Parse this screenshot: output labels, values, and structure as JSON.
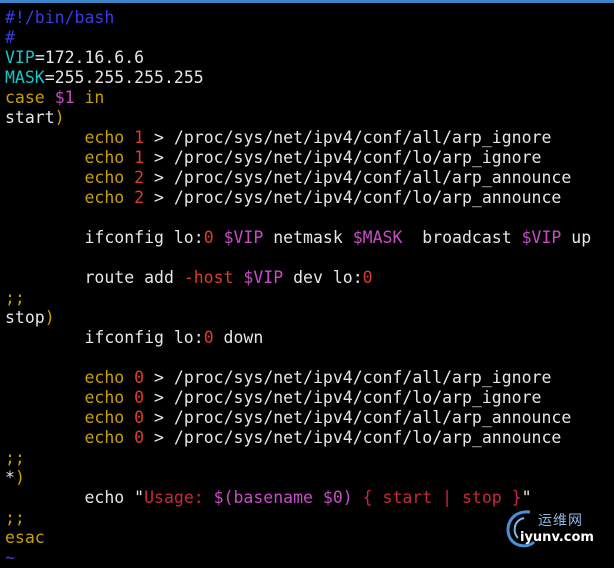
{
  "editor": {
    "lines": [
      [
        {
          "t": "#!/bin/bash",
          "c": "comment"
        }
      ],
      [
        {
          "t": "#",
          "c": "comment"
        }
      ],
      [
        {
          "t": "VIP",
          "c": "var"
        },
        {
          "t": "=172.16.6.6",
          "c": "plain"
        }
      ],
      [
        {
          "t": "MASK",
          "c": "var"
        },
        {
          "t": "=255.255.255.255",
          "c": "plain"
        }
      ],
      [
        {
          "t": "case",
          "c": "keyword"
        },
        {
          "t": " ",
          "c": "plain"
        },
        {
          "t": "$1",
          "c": "dollar"
        },
        {
          "t": " ",
          "c": "plain"
        },
        {
          "t": "in",
          "c": "keyword"
        }
      ],
      [
        {
          "t": "start",
          "c": "plain"
        },
        {
          "t": ")",
          "c": "keyword"
        }
      ],
      [
        {
          "t": "        ",
          "c": "plain"
        },
        {
          "t": "echo",
          "c": "cmd"
        },
        {
          "t": " ",
          "c": "plain"
        },
        {
          "t": "1",
          "c": "num"
        },
        {
          "t": " > /proc/sys/net/ipv4/conf/all/arp_ignore",
          "c": "plain"
        }
      ],
      [
        {
          "t": "        ",
          "c": "plain"
        },
        {
          "t": "echo",
          "c": "cmd"
        },
        {
          "t": " ",
          "c": "plain"
        },
        {
          "t": "1",
          "c": "num"
        },
        {
          "t": " > /proc/sys/net/ipv4/conf/lo/arp_ignore",
          "c": "plain"
        }
      ],
      [
        {
          "t": "        ",
          "c": "plain"
        },
        {
          "t": "echo",
          "c": "cmd"
        },
        {
          "t": " ",
          "c": "plain"
        },
        {
          "t": "2",
          "c": "num"
        },
        {
          "t": " > /proc/sys/net/ipv4/conf/all/arp_announce",
          "c": "plain"
        }
      ],
      [
        {
          "t": "        ",
          "c": "plain"
        },
        {
          "t": "echo",
          "c": "cmd"
        },
        {
          "t": " ",
          "c": "plain"
        },
        {
          "t": "2",
          "c": "num"
        },
        {
          "t": " > /proc/sys/net/ipv4/conf/lo/arp_announce",
          "c": "plain"
        }
      ],
      [],
      [
        {
          "t": "        ifconfig lo:",
          "c": "plain"
        },
        {
          "t": "0",
          "c": "num"
        },
        {
          "t": " ",
          "c": "plain"
        },
        {
          "t": "$VIP",
          "c": "dollar"
        },
        {
          "t": " netmask ",
          "c": "plain"
        },
        {
          "t": "$MASK",
          "c": "dollar"
        },
        {
          "t": "  broadcast ",
          "c": "plain"
        },
        {
          "t": "$VIP",
          "c": "dollar"
        },
        {
          "t": " up",
          "c": "plain"
        }
      ],
      [],
      [
        {
          "t": "        route add ",
          "c": "plain"
        },
        {
          "t": "-host",
          "c": "num"
        },
        {
          "t": " ",
          "c": "plain"
        },
        {
          "t": "$VIP",
          "c": "dollar"
        },
        {
          "t": " dev lo:",
          "c": "plain"
        },
        {
          "t": "0",
          "c": "num"
        }
      ],
      [
        {
          "t": ";;",
          "c": "keyword"
        }
      ],
      [
        {
          "t": "stop",
          "c": "plain"
        },
        {
          "t": ")",
          "c": "keyword"
        }
      ],
      [
        {
          "t": "        ifconfig lo:",
          "c": "plain"
        },
        {
          "t": "0",
          "c": "num"
        },
        {
          "t": " down",
          "c": "plain"
        }
      ],
      [],
      [
        {
          "t": "        ",
          "c": "plain"
        },
        {
          "t": "echo",
          "c": "cmd"
        },
        {
          "t": " ",
          "c": "plain"
        },
        {
          "t": "0",
          "c": "num"
        },
        {
          "t": " > /proc/sys/net/ipv4/conf/all/arp_ignore",
          "c": "plain"
        }
      ],
      [
        {
          "t": "        ",
          "c": "plain"
        },
        {
          "t": "echo",
          "c": "cmd"
        },
        {
          "t": " ",
          "c": "plain"
        },
        {
          "t": "0",
          "c": "num"
        },
        {
          "t": " > /proc/sys/net/ipv4/conf/lo/arp_ignore",
          "c": "plain"
        }
      ],
      [
        {
          "t": "        ",
          "c": "plain"
        },
        {
          "t": "echo",
          "c": "cmd"
        },
        {
          "t": " ",
          "c": "plain"
        },
        {
          "t": "0",
          "c": "num"
        },
        {
          "t": " > /proc/sys/net/ipv4/conf/all/arp_announce",
          "c": "plain"
        }
      ],
      [
        {
          "t": "        ",
          "c": "plain"
        },
        {
          "t": "echo",
          "c": "cmd"
        },
        {
          "t": " ",
          "c": "plain"
        },
        {
          "t": "0",
          "c": "num"
        },
        {
          "t": " > /proc/sys/net/ipv4/conf/lo/arp_announce",
          "c": "plain"
        }
      ],
      [
        {
          "t": ";;",
          "c": "keyword"
        }
      ],
      [
        {
          "t": "*",
          "c": "plain"
        },
        {
          "t": ")",
          "c": "keyword"
        }
      ],
      [
        {
          "t": "        echo ",
          "c": "plain"
        },
        {
          "t": "\"",
          "c": "plain"
        },
        {
          "t": "Usage: ",
          "c": "string"
        },
        {
          "t": "$(basename $0)",
          "c": "dollar"
        },
        {
          "t": " { start | stop }",
          "c": "string"
        },
        {
          "t": "\"",
          "c": "plain"
        }
      ],
      [
        {
          "t": ";;",
          "c": "keyword"
        }
      ],
      [
        {
          "t": "esac",
          "c": "keyword"
        }
      ],
      [
        {
          "t": "~",
          "c": "tilde"
        }
      ]
    ]
  },
  "watermark": {
    "cn_text": "运维网",
    "url_text": "iyunv.com",
    "logo_icon": "swirl-logo-icon"
  },
  "colors": {
    "background": "#000000",
    "top_border": "#3b86c8",
    "comment": "#3a3ae8",
    "variable": "#14c8c8",
    "keyword": "#c8a000",
    "number": "#dc3c28",
    "dollar_var": "#c84bc8",
    "string": "#c8283c"
  }
}
